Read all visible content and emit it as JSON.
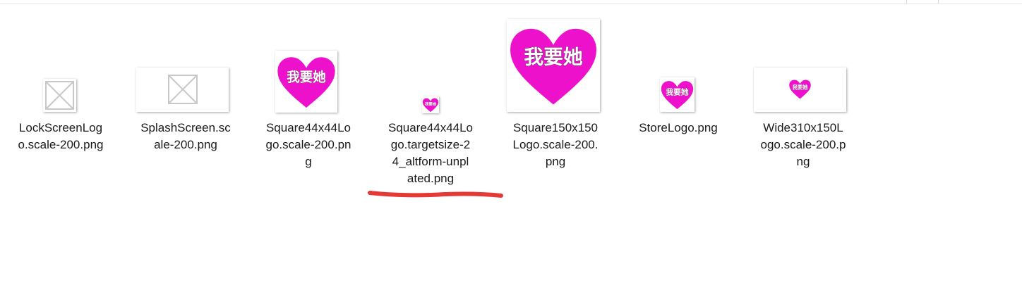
{
  "files": [
    {
      "name": "LockScreenLogo.scale-200.png",
      "label": "LockScreenLog\no.scale-200.png",
      "thumbnail": "broken-image-icon"
    },
    {
      "name": "SplashScreen.scale-200.png",
      "label": "SplashScreen.sc\nale-200.png",
      "thumbnail": "broken-image-icon"
    },
    {
      "name": "Square44x44Logo.scale-200.png",
      "label": "Square44x44Lo\ngo.scale-200.pn\ng",
      "thumbnail": "heart-logo-icon",
      "logo_text": "我要她"
    },
    {
      "name": "Square44x44Logo.targetsize-24_altform-unplated.png",
      "label": "Square44x44Lo\ngo.targetsize-2\n4_altform-unpl\nated.png",
      "thumbnail": "heart-logo-icon",
      "logo_text": "我要她"
    },
    {
      "name": "Square150x150Logo.scale-200.png",
      "label": "Square150x150\nLogo.scale-200.\npng",
      "thumbnail": "heart-logo-icon",
      "logo_text": "我要她"
    },
    {
      "name": "StoreLogo.png",
      "label": "StoreLogo.png",
      "thumbnail": "heart-logo-icon",
      "logo_text": "我要她"
    },
    {
      "name": "Wide310x150Logo.scale-200.png",
      "label": "Wide310x150L\nogo.scale-200.p\nng",
      "thumbnail": "heart-logo-icon",
      "logo_text": "我要她"
    }
  ],
  "annotation": {
    "underline_color": "#e53935",
    "underlined_file": "Square44x44Logo.targetsize-24_altform-unplated.png"
  },
  "colors": {
    "heart": "#ee11cc",
    "text": "#1a1a1a",
    "placeholder": "#c8c8c8"
  }
}
